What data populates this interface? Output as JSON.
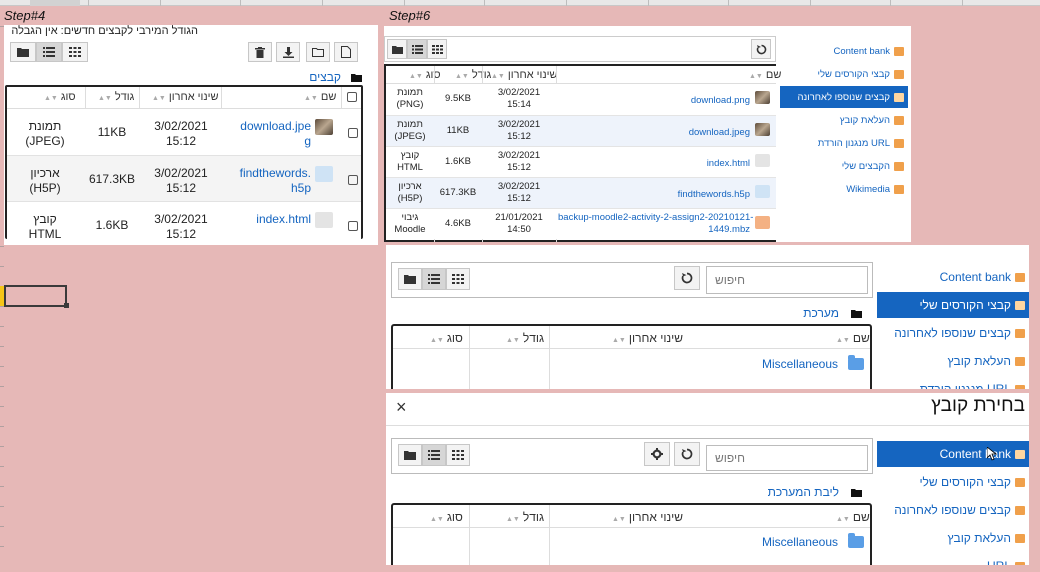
{
  "spreadsheet": {
    "step4_label": "Step#4",
    "step6_label": "Step#6"
  },
  "step4": {
    "max_size_text": "הגודל המירבי לקבצים חדשים: אין הגבלה",
    "breadcrumb": "קבצים",
    "columns": {
      "name": "שם",
      "modified": "שינוי אחרון",
      "size": "גודל",
      "type": "סוג"
    },
    "rows": [
      {
        "name": "download.jpe",
        "name2": "g",
        "date": "3/02/2021",
        "time": "15:12",
        "size": "11KB",
        "type": "תמונת",
        "type2": "(JPEG)",
        "icon": "image-thumbnail-icon"
      },
      {
        "name": "findthewords.",
        "name2": "h5p",
        "date": "3/02/2021",
        "time": "15:12",
        "size": "617.3KB",
        "type": "ארכיון",
        "type2": "(H5P)",
        "icon": "h5p-file-icon"
      },
      {
        "name": "index.html",
        "name2": "",
        "date": "3/02/2021",
        "time": "15:12",
        "size": "1.6KB",
        "type": "קובץ",
        "type2": "HTML",
        "icon": "html-file-icon"
      }
    ]
  },
  "step6": {
    "columns": {
      "name": "שם",
      "modified": "שינוי אחרון",
      "size": "גודל",
      "type": "סוג"
    },
    "rows": [
      {
        "name": "download.png",
        "name2": "",
        "date": "3/02/2021",
        "time": "15:14",
        "size": "9.5KB",
        "type": "תמונת",
        "type2": "(PNG)",
        "icon": "image-thumbnail-icon"
      },
      {
        "name": "download.jpeg",
        "name2": "",
        "date": "3/02/2021",
        "time": "15:12",
        "size": "11KB",
        "type": "תמונת",
        "type2": "(JPEG)",
        "icon": "image-thumbnail-icon"
      },
      {
        "name": "index.html",
        "name2": "",
        "date": "3/02/2021",
        "time": "15:12",
        "size": "1.6KB",
        "type": "קובץ",
        "type2": "HTML",
        "icon": "html-file-icon"
      },
      {
        "name": "findthewords.h5p",
        "name2": "",
        "date": "3/02/2021",
        "time": "15:12",
        "size": "617.3KB",
        "type": "ארכיון",
        "type2": "(H5P)",
        "icon": "h5p-file-icon"
      },
      {
        "name": "backup-moodle2-activity-2-assign2-20210121-",
        "name2": "1449.mbz",
        "date": "21/01/2021",
        "time": "14:50",
        "size": "4.6KB",
        "type": "גיבוי",
        "type2": "Moodle",
        "icon": "moodle-backup-icon"
      }
    ],
    "nav": [
      {
        "label": "Content bank"
      },
      {
        "label": "קבצי הקורסים שלי"
      },
      {
        "label": "קבצים שנוספו לאחרונה"
      },
      {
        "label": "העלאת קובץ"
      },
      {
        "label": "מנגנון הורדת URL"
      },
      {
        "label": "הקבצים שלי"
      },
      {
        "label": "Wikimedia"
      }
    ]
  },
  "panel3": {
    "search_placeholder": "חיפוש",
    "breadcrumb": "מערכת",
    "columns": {
      "name": "שם",
      "modified": "שינוי אחרון",
      "size": "גודל",
      "type": "סוג"
    },
    "folder": "Miscellaneous",
    "nav": [
      {
        "label": "Content bank"
      },
      {
        "label": "קבצי הקורסים שלי"
      },
      {
        "label": "קבצים שנוספו לאחרונה"
      },
      {
        "label": "העלאת קובץ"
      },
      {
        "label": "מנגנון הורדת URL"
      }
    ]
  },
  "panel4": {
    "dialog_title": "בחירת קובץ",
    "close_label": "×",
    "search_placeholder": "חיפוש",
    "breadcrumb": "ליבת המערכת",
    "columns": {
      "name": "שם",
      "modified": "שינוי אחרון",
      "size": "גודל",
      "type": "סוג"
    },
    "folder": "Miscellaneous",
    "nav": [
      {
        "label": "Content bank"
      },
      {
        "label": "קבצי הקורסים שלי"
      },
      {
        "label": "קבצים שנוספו לאחרונה"
      },
      {
        "label": "העלאת קובץ"
      },
      {
        "label": "URL"
      }
    ]
  },
  "colors": {
    "accent": "#1565c0",
    "sheet_fill": "#e6b8b7",
    "selected_cell": "#f5c518"
  }
}
